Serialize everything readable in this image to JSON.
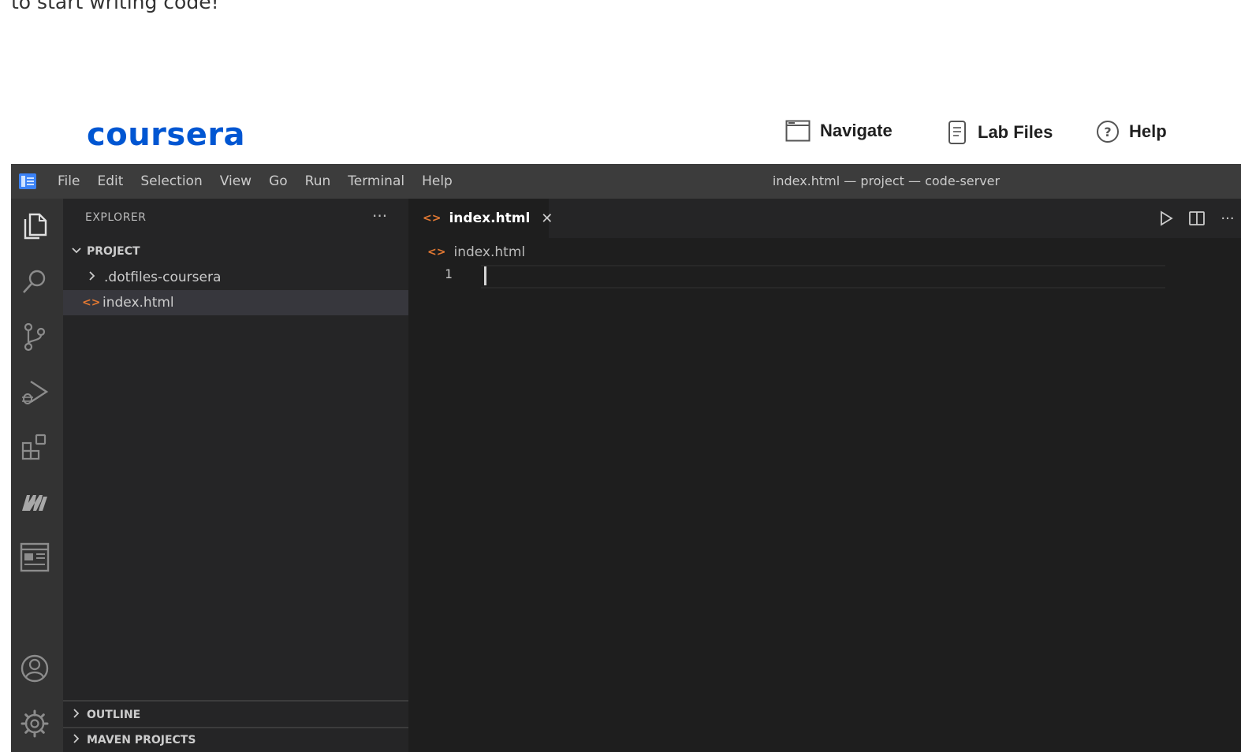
{
  "intro_text": "to start writing code!",
  "coursera": {
    "logo": "coursera",
    "nav": [
      {
        "label": "Navigate",
        "icon": "window-icon"
      },
      {
        "label": "Lab Files",
        "icon": "document-icon"
      },
      {
        "label": "Help",
        "icon": "help-circle-icon"
      }
    ]
  },
  "ide": {
    "menu": [
      "File",
      "Edit",
      "Selection",
      "View",
      "Go",
      "Run",
      "Terminal",
      "Help"
    ],
    "window_title": "index.html — project — code-server",
    "activity_bar": [
      "explorer-icon",
      "search-icon",
      "source-control-icon",
      "run-debug-icon",
      "extensions-icon",
      "maven-icon",
      "browser-preview-icon",
      "account-icon",
      "settings-gear-icon"
    ],
    "sidebar": {
      "title": "EXPLORER",
      "more": "···",
      "project_section": "PROJECT",
      "items": [
        {
          "label": ".dotfiles-coursera",
          "type": "folder"
        },
        {
          "label": "index.html",
          "type": "file",
          "selected": true
        }
      ],
      "outline_section": "OUTLINE",
      "maven_section": "MAVEN PROJECTS"
    },
    "editor": {
      "tab_label": "index.html",
      "tab_close": "✕",
      "breadcrumb": "index.html",
      "file_icon_glyph": "<>",
      "line_number": "1"
    },
    "colors": {
      "accent_file_icon": "#e37933",
      "logo_blue": "#0056d2",
      "titlebar": "#3c3c3c",
      "activity_bar": "#333333",
      "sidebar": "#252526",
      "editor": "#1e1e1e"
    }
  }
}
